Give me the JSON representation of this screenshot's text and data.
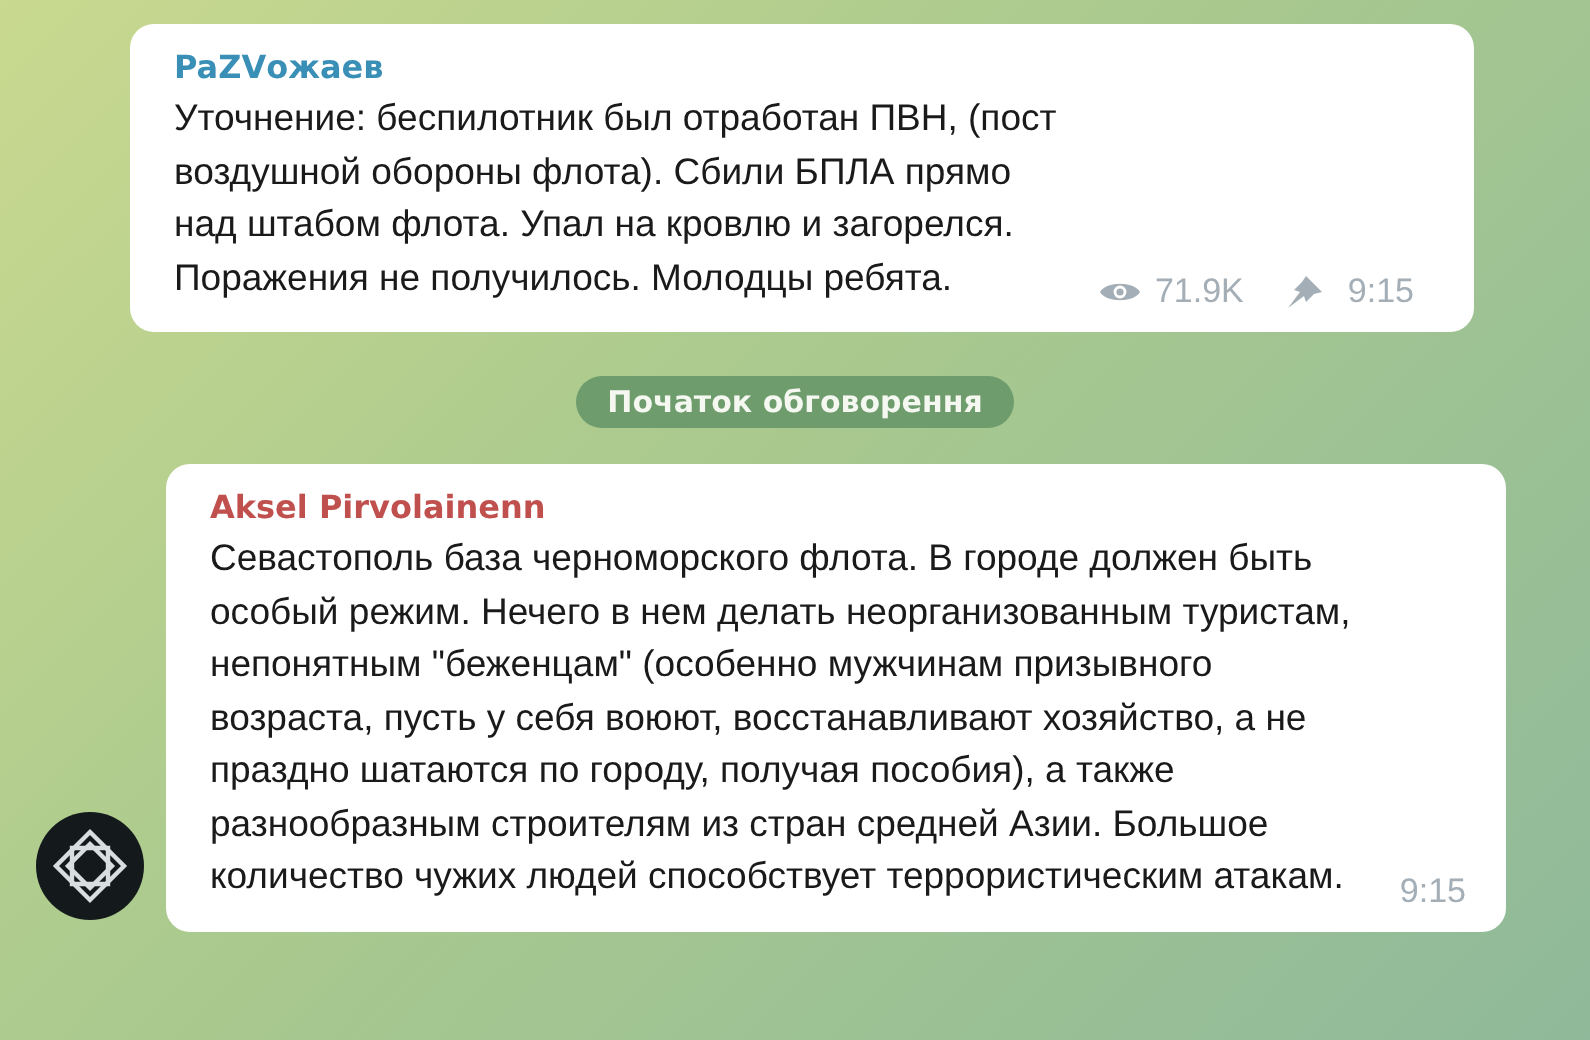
{
  "messages": [
    {
      "kind": "channel",
      "author": "PaZVожаев",
      "text": "Уточнение: беспилотник был отработан ПВН, (пост воздушной обороны флота). Сбили БПЛА прямо над штабом флота. Упал на кровлю и загорелся. Поражения не получилось. Молодцы ребята.",
      "views": "71.9K",
      "pinned": true,
      "time": "9:15"
    },
    {
      "kind": "service",
      "text": "Початок обговорення"
    },
    {
      "kind": "comment",
      "author": "Aksel Pirvolainenn",
      "text": "Севастополь база черноморского флота. В городе должен быть особый режим. Нечего в нем делать неорганизованным туристам, непонятным \"беженцам\" (особенно мужчинам призывного возраста, пусть у себя воюют, восстанавливают хозяйство, а не праздно шатаются по городу, получая пособия), а также разнообразным строителям из стран средней Азии. Большое количество чужих людей способствует террористическим атакам.",
      "time": "9:15"
    }
  ]
}
